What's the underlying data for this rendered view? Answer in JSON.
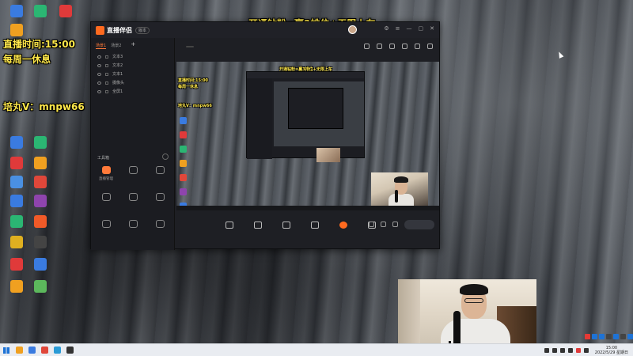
{
  "overlays": {
    "top_banner": "开通钻粉=赢3排位+无限上车",
    "schedule_line1": "直播时间:15:00",
    "schedule_line2": "每周一休息",
    "wechat": "培丸V：mnpw66"
  },
  "desktop_icons": [
    {
      "label": "",
      "color": "#3a7be0"
    },
    {
      "label": "",
      "color": "#2bb673"
    },
    {
      "label": "",
      "color": "#e03a3a"
    },
    {
      "label": "",
      "color": "#f0a020"
    },
    {
      "label": "",
      "color": "#4a90e2"
    },
    {
      "label": "",
      "color": "#e0473a"
    },
    {
      "label": "",
      "color": "#3a7be0"
    },
    {
      "label": "",
      "color": "#8e44ad"
    },
    {
      "label": "",
      "color": "#2bb673"
    },
    {
      "label": "",
      "color": "#f05a28"
    },
    {
      "label": "",
      "color": "#e0b020"
    },
    {
      "label": "",
      "color": "#444"
    },
    {
      "label": "",
      "color": "#e03a3a"
    },
    {
      "label": "",
      "color": "#3a7be0"
    },
    {
      "label": "",
      "color": "#f0a020"
    },
    {
      "label": "",
      "color": "#5cb85c"
    }
  ],
  "app": {
    "name": "直播伴侣",
    "version": "版本",
    "scene_tabs": [
      "场景1",
      "场景2"
    ],
    "layers": [
      "文本3",
      "文本2",
      "文本1",
      "摄像头",
      "全屏1"
    ],
    "tools_title": "工具箱",
    "tools": [
      {
        "label": "直播管理",
        "hot": true
      },
      {
        "label": "",
        "hot": false
      },
      {
        "label": "",
        "hot": false
      },
      {
        "label": "",
        "hot": false
      },
      {
        "label": "",
        "hot": false
      },
      {
        "label": "",
        "hot": false
      },
      {
        "label": "",
        "hot": false
      },
      {
        "label": "",
        "hot": false
      },
      {
        "label": "",
        "hot": false
      }
    ],
    "footer_left": "",
    "stream": {
      "header_title": "",
      "header_pill": "",
      "sub_tag": "",
      "sub_items": []
    },
    "preview_overlays": {
      "top_banner": "开通钻粉=赢3排位+无限上车",
      "schedule_line1": "直播时间:15:00",
      "schedule_line2": "每周一休息",
      "wechat": "培丸V：mnpw66"
    },
    "live_toolbar": [
      {
        "label": "",
        "red": false
      },
      {
        "label": "",
        "red": false
      },
      {
        "label": "",
        "red": false
      },
      {
        "label": "",
        "red": false
      },
      {
        "label": "",
        "red": true
      },
      {
        "label": "",
        "red": false
      }
    ],
    "start_live_label": "",
    "status_items": []
  },
  "taskbar": {
    "apps": [
      "#f0a020",
      "#3a7be0",
      "#e0473a",
      "#2a9bd6",
      "#333"
    ],
    "tray_icons": [
      "#333",
      "#333",
      "#333",
      "#333",
      "#e03a3a",
      "#333"
    ],
    "clock_time": "15:00",
    "clock_date": "2022/5/29 星期日"
  },
  "ime_colors": [
    "#e53935",
    "#1e73d6",
    "#1e73d6",
    "#444",
    "#1e73d6",
    "#444",
    "#1e73d6"
  ]
}
